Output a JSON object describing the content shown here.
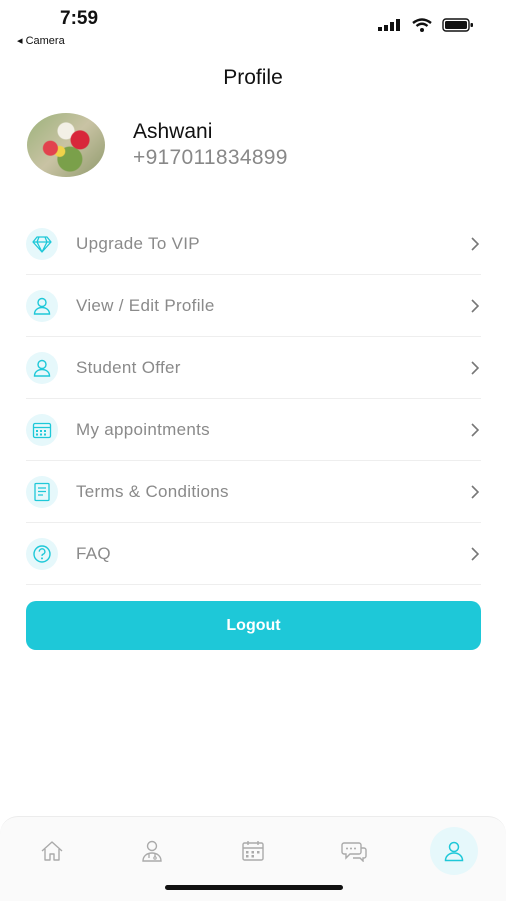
{
  "status_bar": {
    "time": "7:59",
    "back_app": "◂ Camera",
    "icons": [
      "signal-icon",
      "wifi-icon",
      "battery-icon"
    ]
  },
  "header": {
    "title": "Profile"
  },
  "profile": {
    "name": "Ashwani",
    "phone": "+917011834899"
  },
  "menu": {
    "items": [
      {
        "label": "Upgrade To VIP",
        "icon": "diamond-icon"
      },
      {
        "label": "View / Edit Profile",
        "icon": "user-icon"
      },
      {
        "label": "Student Offer",
        "icon": "user-icon"
      },
      {
        "label": "My appointments",
        "icon": "calendar-icon"
      },
      {
        "label": "Terms & Conditions",
        "icon": "document-icon"
      },
      {
        "label": "FAQ",
        "icon": "question-icon"
      }
    ]
  },
  "logout": {
    "label": "Logout"
  },
  "tab_bar": {
    "tabs": [
      {
        "icon": "home-icon",
        "active": false
      },
      {
        "icon": "doctor-icon",
        "active": false
      },
      {
        "icon": "calendar-icon",
        "active": false
      },
      {
        "icon": "chat-icon",
        "active": false
      },
      {
        "icon": "profile-icon",
        "active": true
      }
    ]
  },
  "colors": {
    "accent": "#1ec8d8",
    "icon_bg": "#e6f8fb",
    "label": "#8a8a8a"
  }
}
